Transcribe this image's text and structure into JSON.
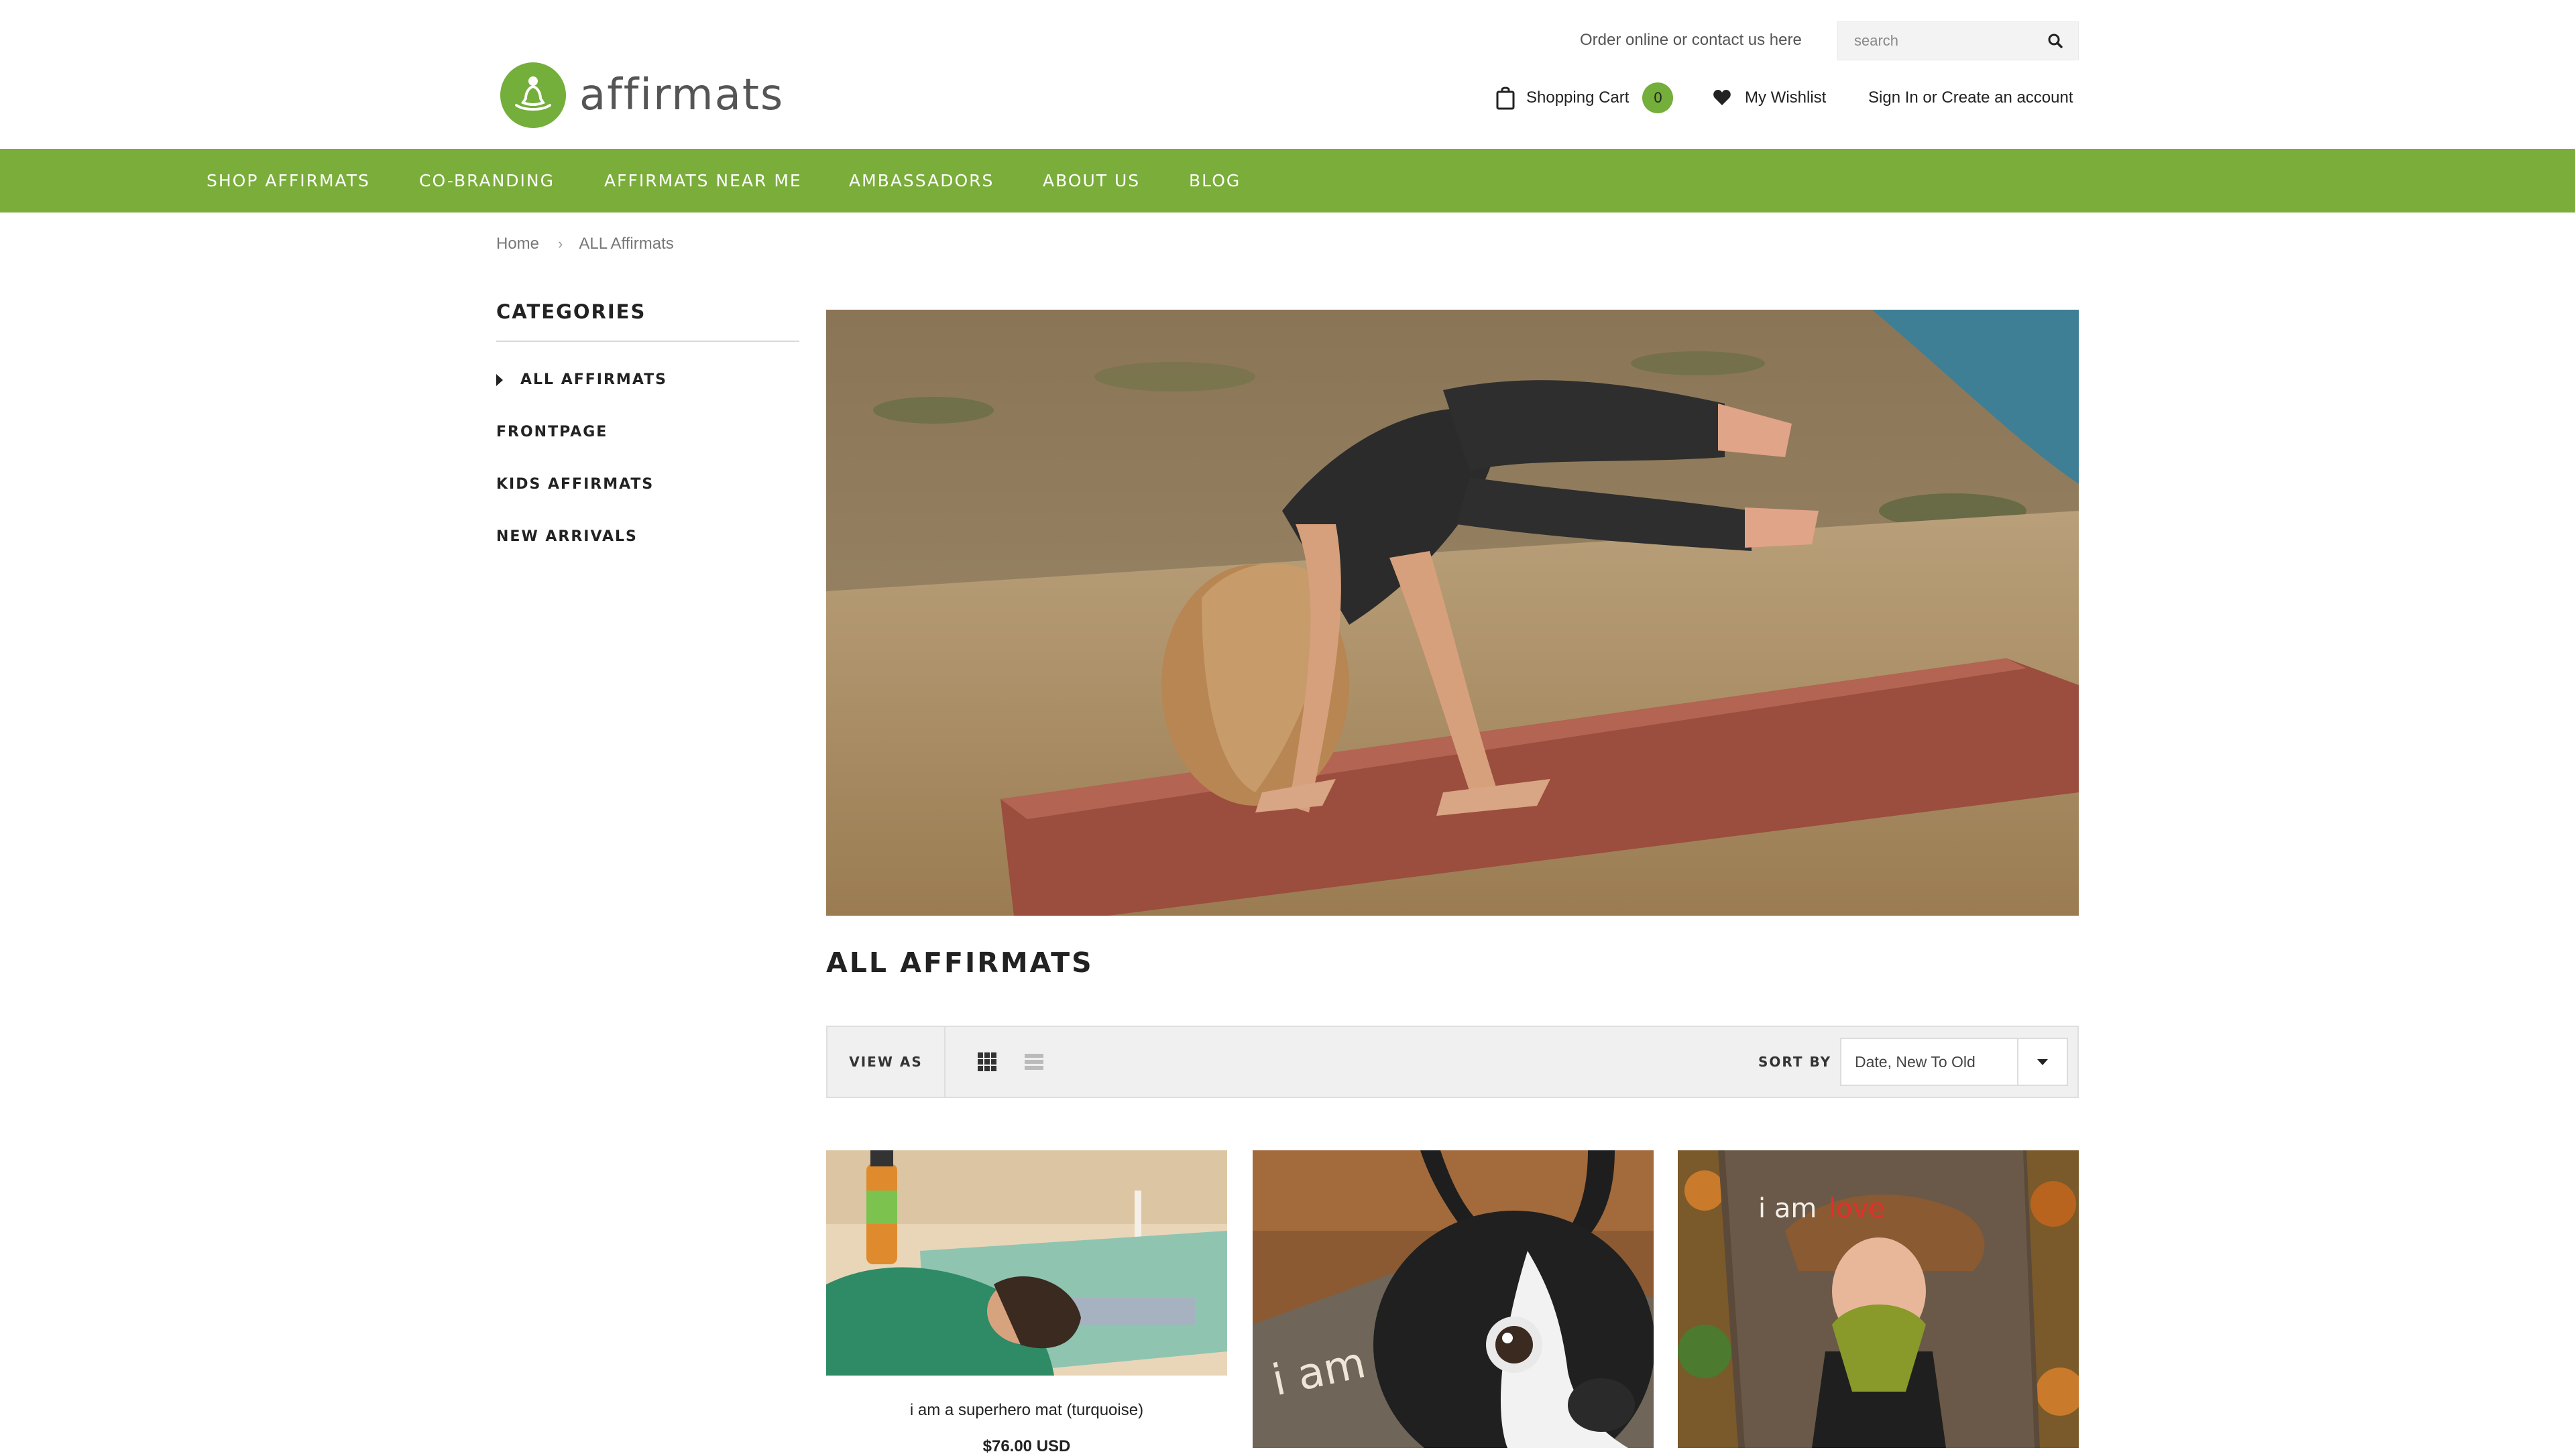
{
  "brand": {
    "name": "affirmats",
    "logo_color": "#74ae3b"
  },
  "header": {
    "order_link": "Order online or contact us here",
    "search": {
      "placeholder": "search",
      "icon": "search-icon"
    },
    "cart": {
      "label": "Shopping Cart",
      "count": "0",
      "icon": "shopping-bag-icon"
    },
    "wishlist": {
      "label": "My Wishlist",
      "icon": "heart-icon"
    },
    "account": {
      "label": "Sign In or Create an account"
    }
  },
  "nav": {
    "background": "#7aad3a",
    "items": [
      {
        "label": "SHOP AFFIRMATS"
      },
      {
        "label": "CO-BRANDING"
      },
      {
        "label": "AFFIRMATS NEAR ME"
      },
      {
        "label": "AMBASSADORS"
      },
      {
        "label": "ABOUT US"
      },
      {
        "label": "BLOG"
      }
    ]
  },
  "breadcrumb": {
    "home": "Home",
    "separator": "›",
    "current": "ALL Affirmats"
  },
  "sidebar": {
    "title": "CATEGORIES",
    "categories": [
      {
        "label": "ALL AFFIRMATS",
        "active": true
      },
      {
        "label": "FRONTPAGE"
      },
      {
        "label": "KIDS AFFIRMATS"
      },
      {
        "label": "NEW ARRIVALS"
      }
    ]
  },
  "collection": {
    "title": "ALL AFFIRMATS"
  },
  "toolbar": {
    "view_as_label": "VIEW AS",
    "view_modes": [
      {
        "icon": "grid-view-icon",
        "active": true
      },
      {
        "icon": "list-view-icon",
        "active": false
      }
    ],
    "sort_label": "SORT BY",
    "sort_value": "Date, New To Old"
  },
  "products": [
    {
      "name": "i am a superhero mat (turquoise)",
      "price": "$76.00 USD"
    },
    {
      "mat_text": "i am"
    },
    {
      "mat_text_1": "i am",
      "mat_text_2": "love"
    }
  ]
}
